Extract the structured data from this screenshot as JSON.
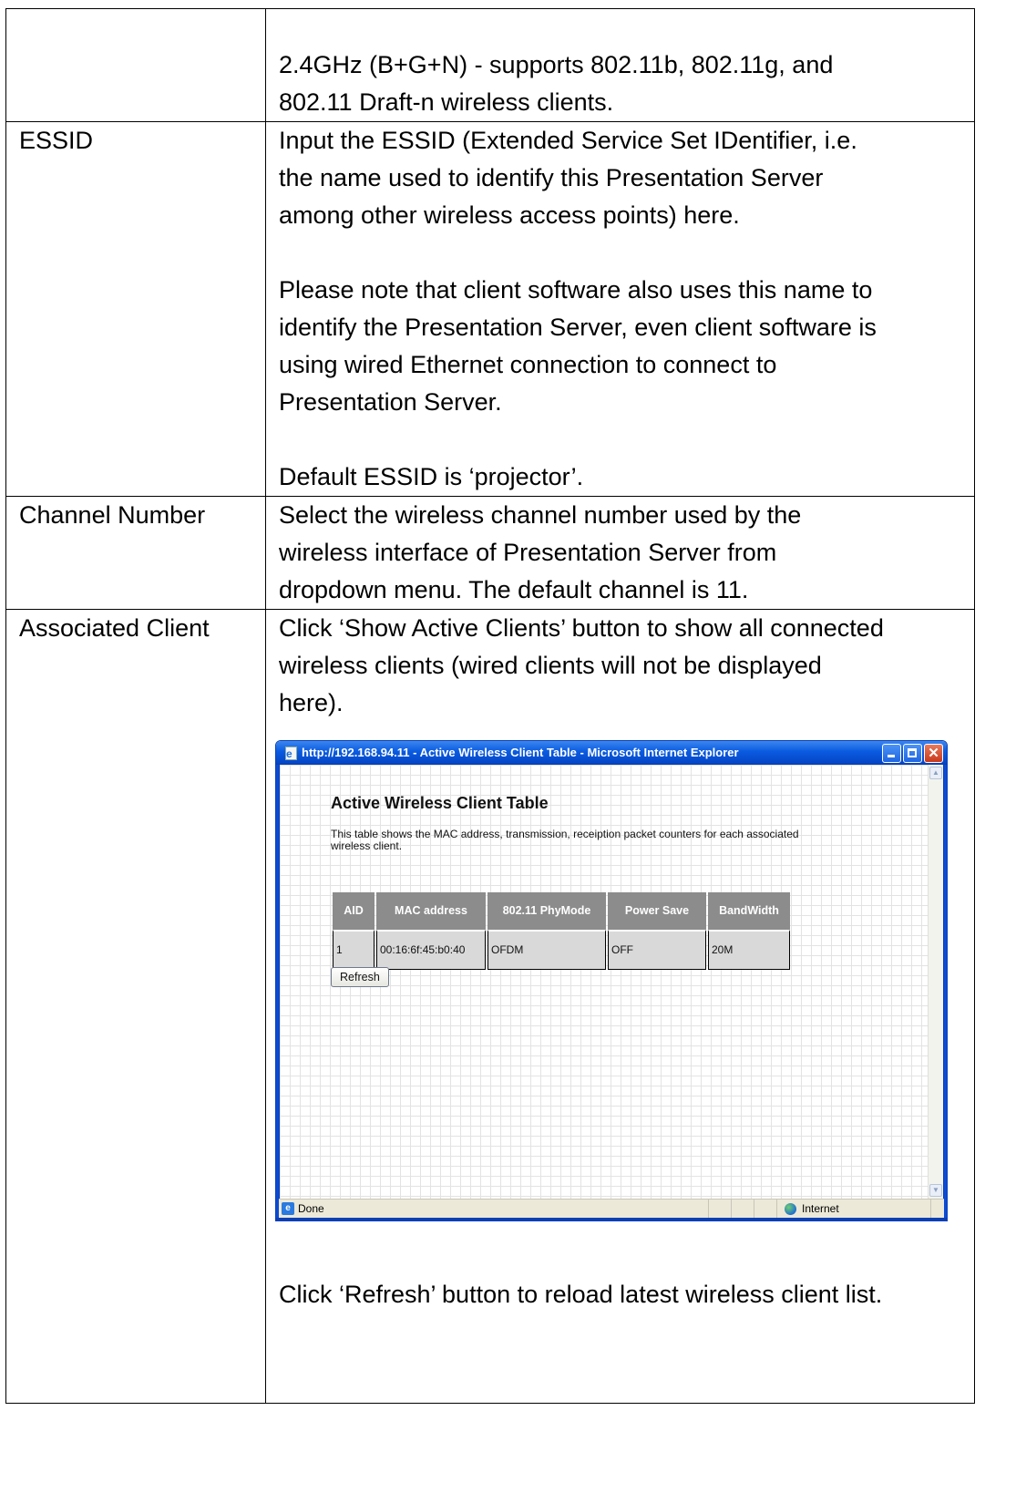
{
  "rows": [
    {
      "label": "",
      "paragraphs": [
        "2.4GHz (B+G+N) - supports 802.11b, 802.11g, and",
        "802.11 Draft-n wireless clients."
      ]
    },
    {
      "label": "ESSID",
      "paragraphs": [
        "Input the ESSID (Extended Service Set IDentifier, i.e.",
        "the name used to identify this Presentation Server",
        "among other wireless access points) here.",
        "",
        "Please note that client software also uses this name to",
        "identify the Presentation Server, even client software is",
        "using wired Ethernet connection to connect to",
        "Presentation Server.",
        "",
        "Default ESSID is ‘projector’."
      ]
    },
    {
      "label": "Channel Number",
      "paragraphs": [
        "Select the wireless channel number used by the",
        "wireless interface of Presentation Server from",
        "dropdown menu. The default channel is 11."
      ]
    },
    {
      "label": "Associated Client",
      "intro": [
        "Click ‘Show Active Clients’ button to show all connected",
        "wireless clients (wired clients will not be displayed",
        "here)."
      ],
      "outro": "Click ‘Refresh’ button to reload latest wireless client list."
    }
  ],
  "browser": {
    "title": "http://192.168.94.11 - Active Wireless Client Table - Microsoft Internet Explorer",
    "heading": "Active Wireless Client Table",
    "description": "This table shows the MAC address, transmission, receiption packet counters for each associated wireless client.",
    "table": {
      "headers": [
        "AID",
        "MAC address",
        "802.11 PhyMode",
        "Power Save",
        "BandWidth"
      ],
      "rows": [
        [
          "1",
          "00:16:6f:45:b0:40",
          "OFDM",
          "OFF",
          "20M"
        ]
      ]
    },
    "refresh_label": "Refresh",
    "status_left": "Done",
    "status_zone": "Internet"
  }
}
